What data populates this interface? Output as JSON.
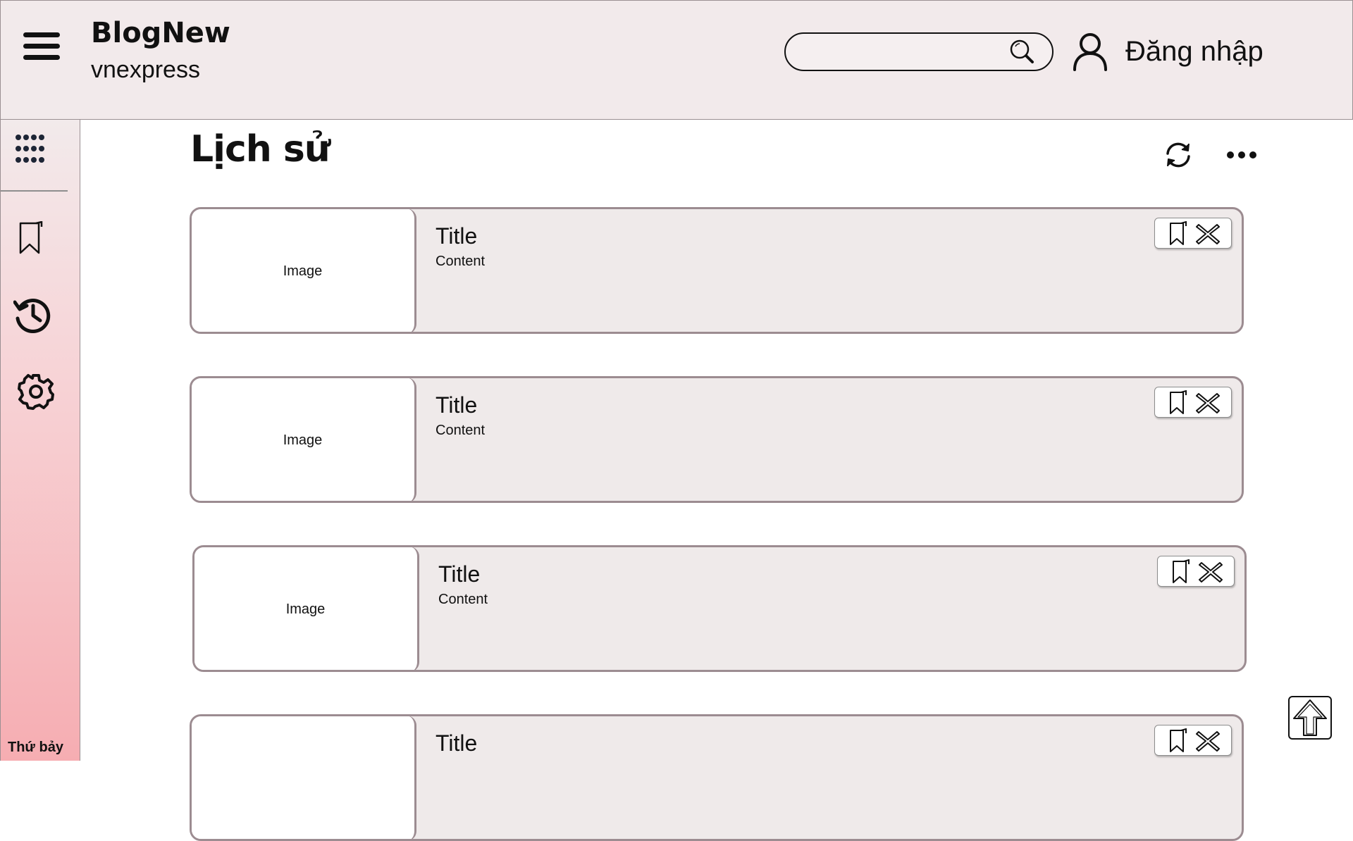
{
  "header": {
    "brand_title": "BlogNew",
    "brand_subtitle": "vnexpress",
    "search_placeholder": "",
    "login_label": "Đăng nhập"
  },
  "sidebar": {
    "items": [
      {
        "icon": "apps-grid-icon"
      },
      {
        "icon": "bookmark-icon"
      },
      {
        "icon": "history-icon"
      },
      {
        "icon": "settings-gear-icon"
      }
    ],
    "day_label": "Thứ bảy"
  },
  "main": {
    "page_title": "Lịch sử",
    "cards": [
      {
        "image_label": "Image",
        "title": "Title",
        "content": "Content"
      },
      {
        "image_label": "Image",
        "title": "Title",
        "content": "Content"
      },
      {
        "image_label": "Image",
        "title": "Title",
        "content": "Content"
      },
      {
        "image_label": "",
        "title": "Title",
        "content": ""
      }
    ]
  },
  "colors": {
    "header_bg": "#f2eaeb",
    "card_bg": "#efeaea",
    "card_border": "#9c8c91",
    "sidebar_gradient_bottom": "#f6adb2"
  }
}
